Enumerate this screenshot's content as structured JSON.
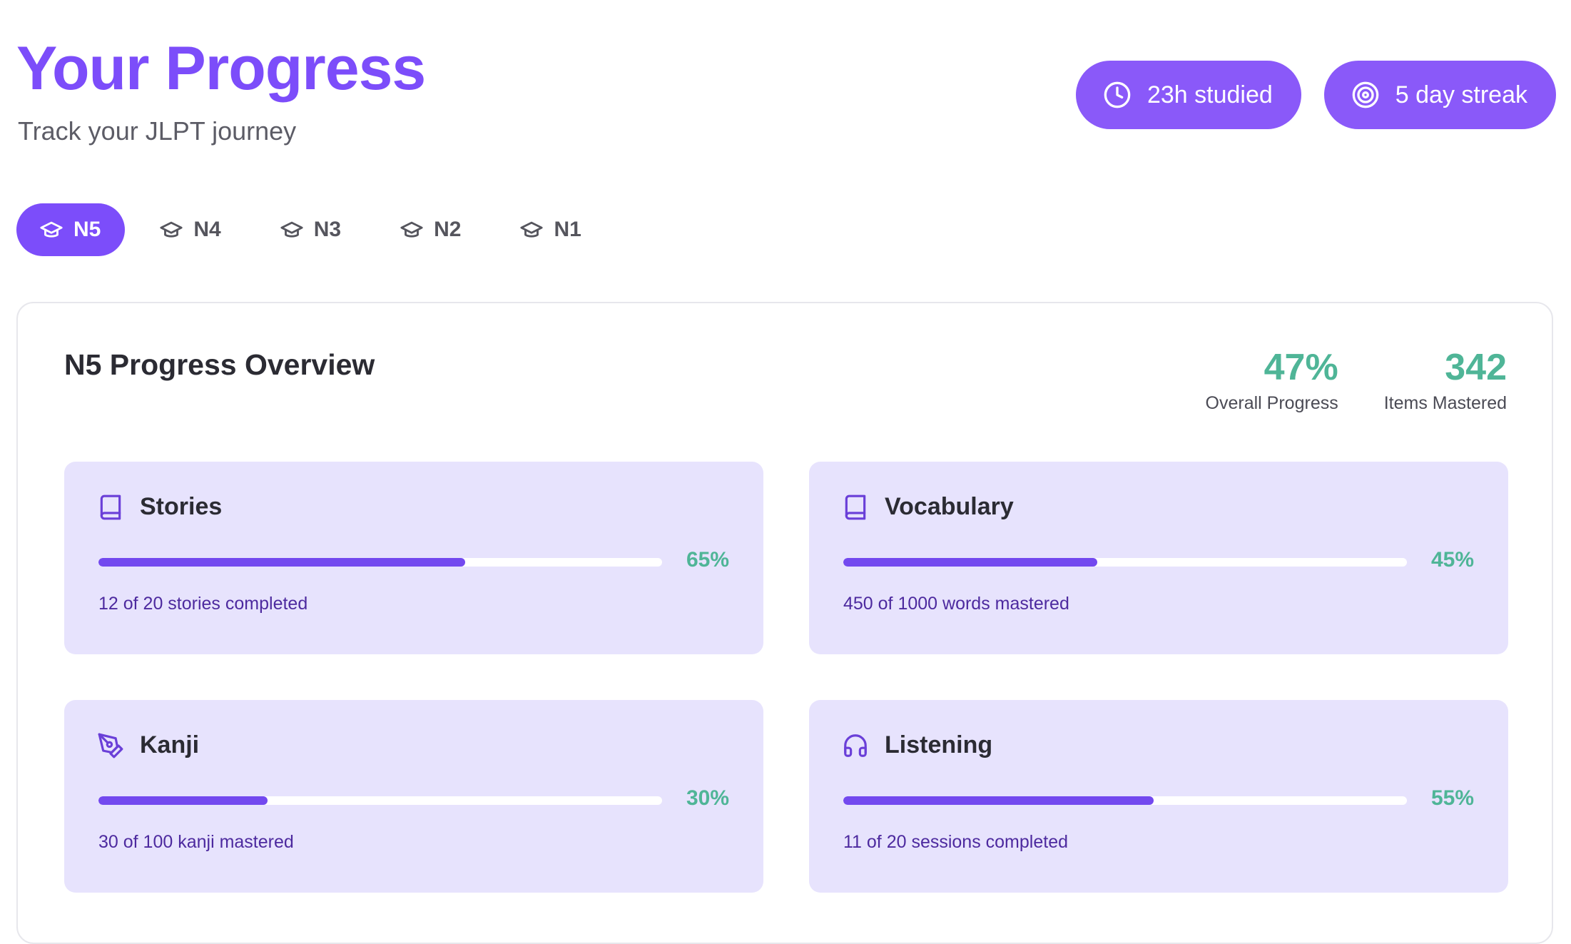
{
  "header": {
    "title": "Your Progress",
    "subtitle": "Track your JLPT journey"
  },
  "stats": [
    {
      "label": "23h studied",
      "icon": "clock-icon"
    },
    {
      "label": "5 day streak",
      "icon": "target-icon"
    }
  ],
  "levels": {
    "active": "N5",
    "items": [
      {
        "label": "N5",
        "icon": "graduation-cap-icon"
      },
      {
        "label": "N4",
        "icon": "graduation-cap-icon"
      },
      {
        "label": "N3",
        "icon": "graduation-cap-icon"
      },
      {
        "label": "N2",
        "icon": "graduation-cap-icon"
      },
      {
        "label": "N1",
        "icon": "graduation-cap-icon"
      }
    ]
  },
  "overview": {
    "title": "N5 Progress Overview",
    "overall_value": "47%",
    "overall_label": "Overall Progress",
    "mastered_value": "342",
    "mastered_label": "Items Mastered"
  },
  "categories": [
    {
      "name": "Stories",
      "icon": "book-icon",
      "percent_label": "65%",
      "progress": 0.65,
      "detail": "12 of 20 stories completed"
    },
    {
      "name": "Vocabulary",
      "icon": "book-icon",
      "percent_label": "45%",
      "progress": 0.45,
      "detail": "450 of 1000 words mastered"
    },
    {
      "name": "Kanji",
      "icon": "pen-tool-icon",
      "percent_label": "30%",
      "progress": 0.3,
      "detail": "30 of 100 kanji mastered"
    },
    {
      "name": "Listening",
      "icon": "headphones-icon",
      "percent_label": "55%",
      "progress": 0.55,
      "detail": "11 of 20 sessions completed"
    }
  ],
  "colors": {
    "accent": "#7c4dfa",
    "success": "#4fb597",
    "card_background": "#e7e3fd",
    "progress_fill": "#7349ef"
  }
}
